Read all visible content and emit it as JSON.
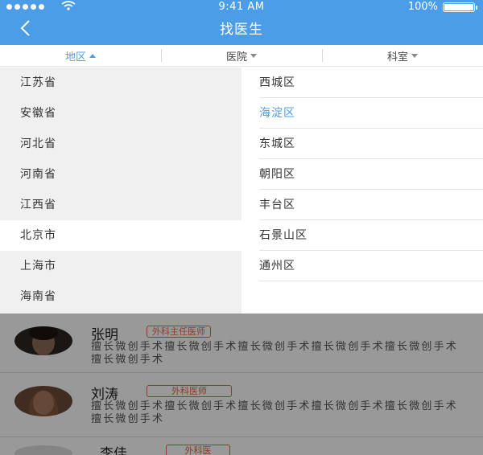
{
  "status_bar": {
    "time": "9:41 AM",
    "battery": "100%"
  },
  "nav": {
    "title": "找医生"
  },
  "tabs": [
    {
      "label": "地区",
      "active": true
    },
    {
      "label": "医院",
      "active": false
    },
    {
      "label": "科室",
      "active": false
    }
  ],
  "provinces": [
    "江苏省",
    "安徽省",
    "河北省",
    "河南省",
    "江西省",
    "北京市",
    "上海市",
    "海南省"
  ],
  "selected_province": "北京市",
  "districts": [
    "西城区",
    "海淀区",
    "东城区",
    "朝阳区",
    "丰台区",
    "石景山区",
    "通州区"
  ],
  "selected_district": "海淀区",
  "doctors": [
    {
      "name": "张明",
      "title": "外科主任医师",
      "desc": "擅长微创手术擅长微创手术擅长微创手术擅长微创手术擅长微创手术擅长微创手术"
    },
    {
      "name": "刘涛",
      "title": "外科医师",
      "desc": "擅长微创手术擅长微创手术擅长微创手术擅长微创手术擅长微创手术擅长微创手术"
    },
    {
      "name": "李佳",
      "title": "外科医"
    }
  ],
  "colors": {
    "primary": "#4a9de6",
    "badge": "#e2684a"
  }
}
